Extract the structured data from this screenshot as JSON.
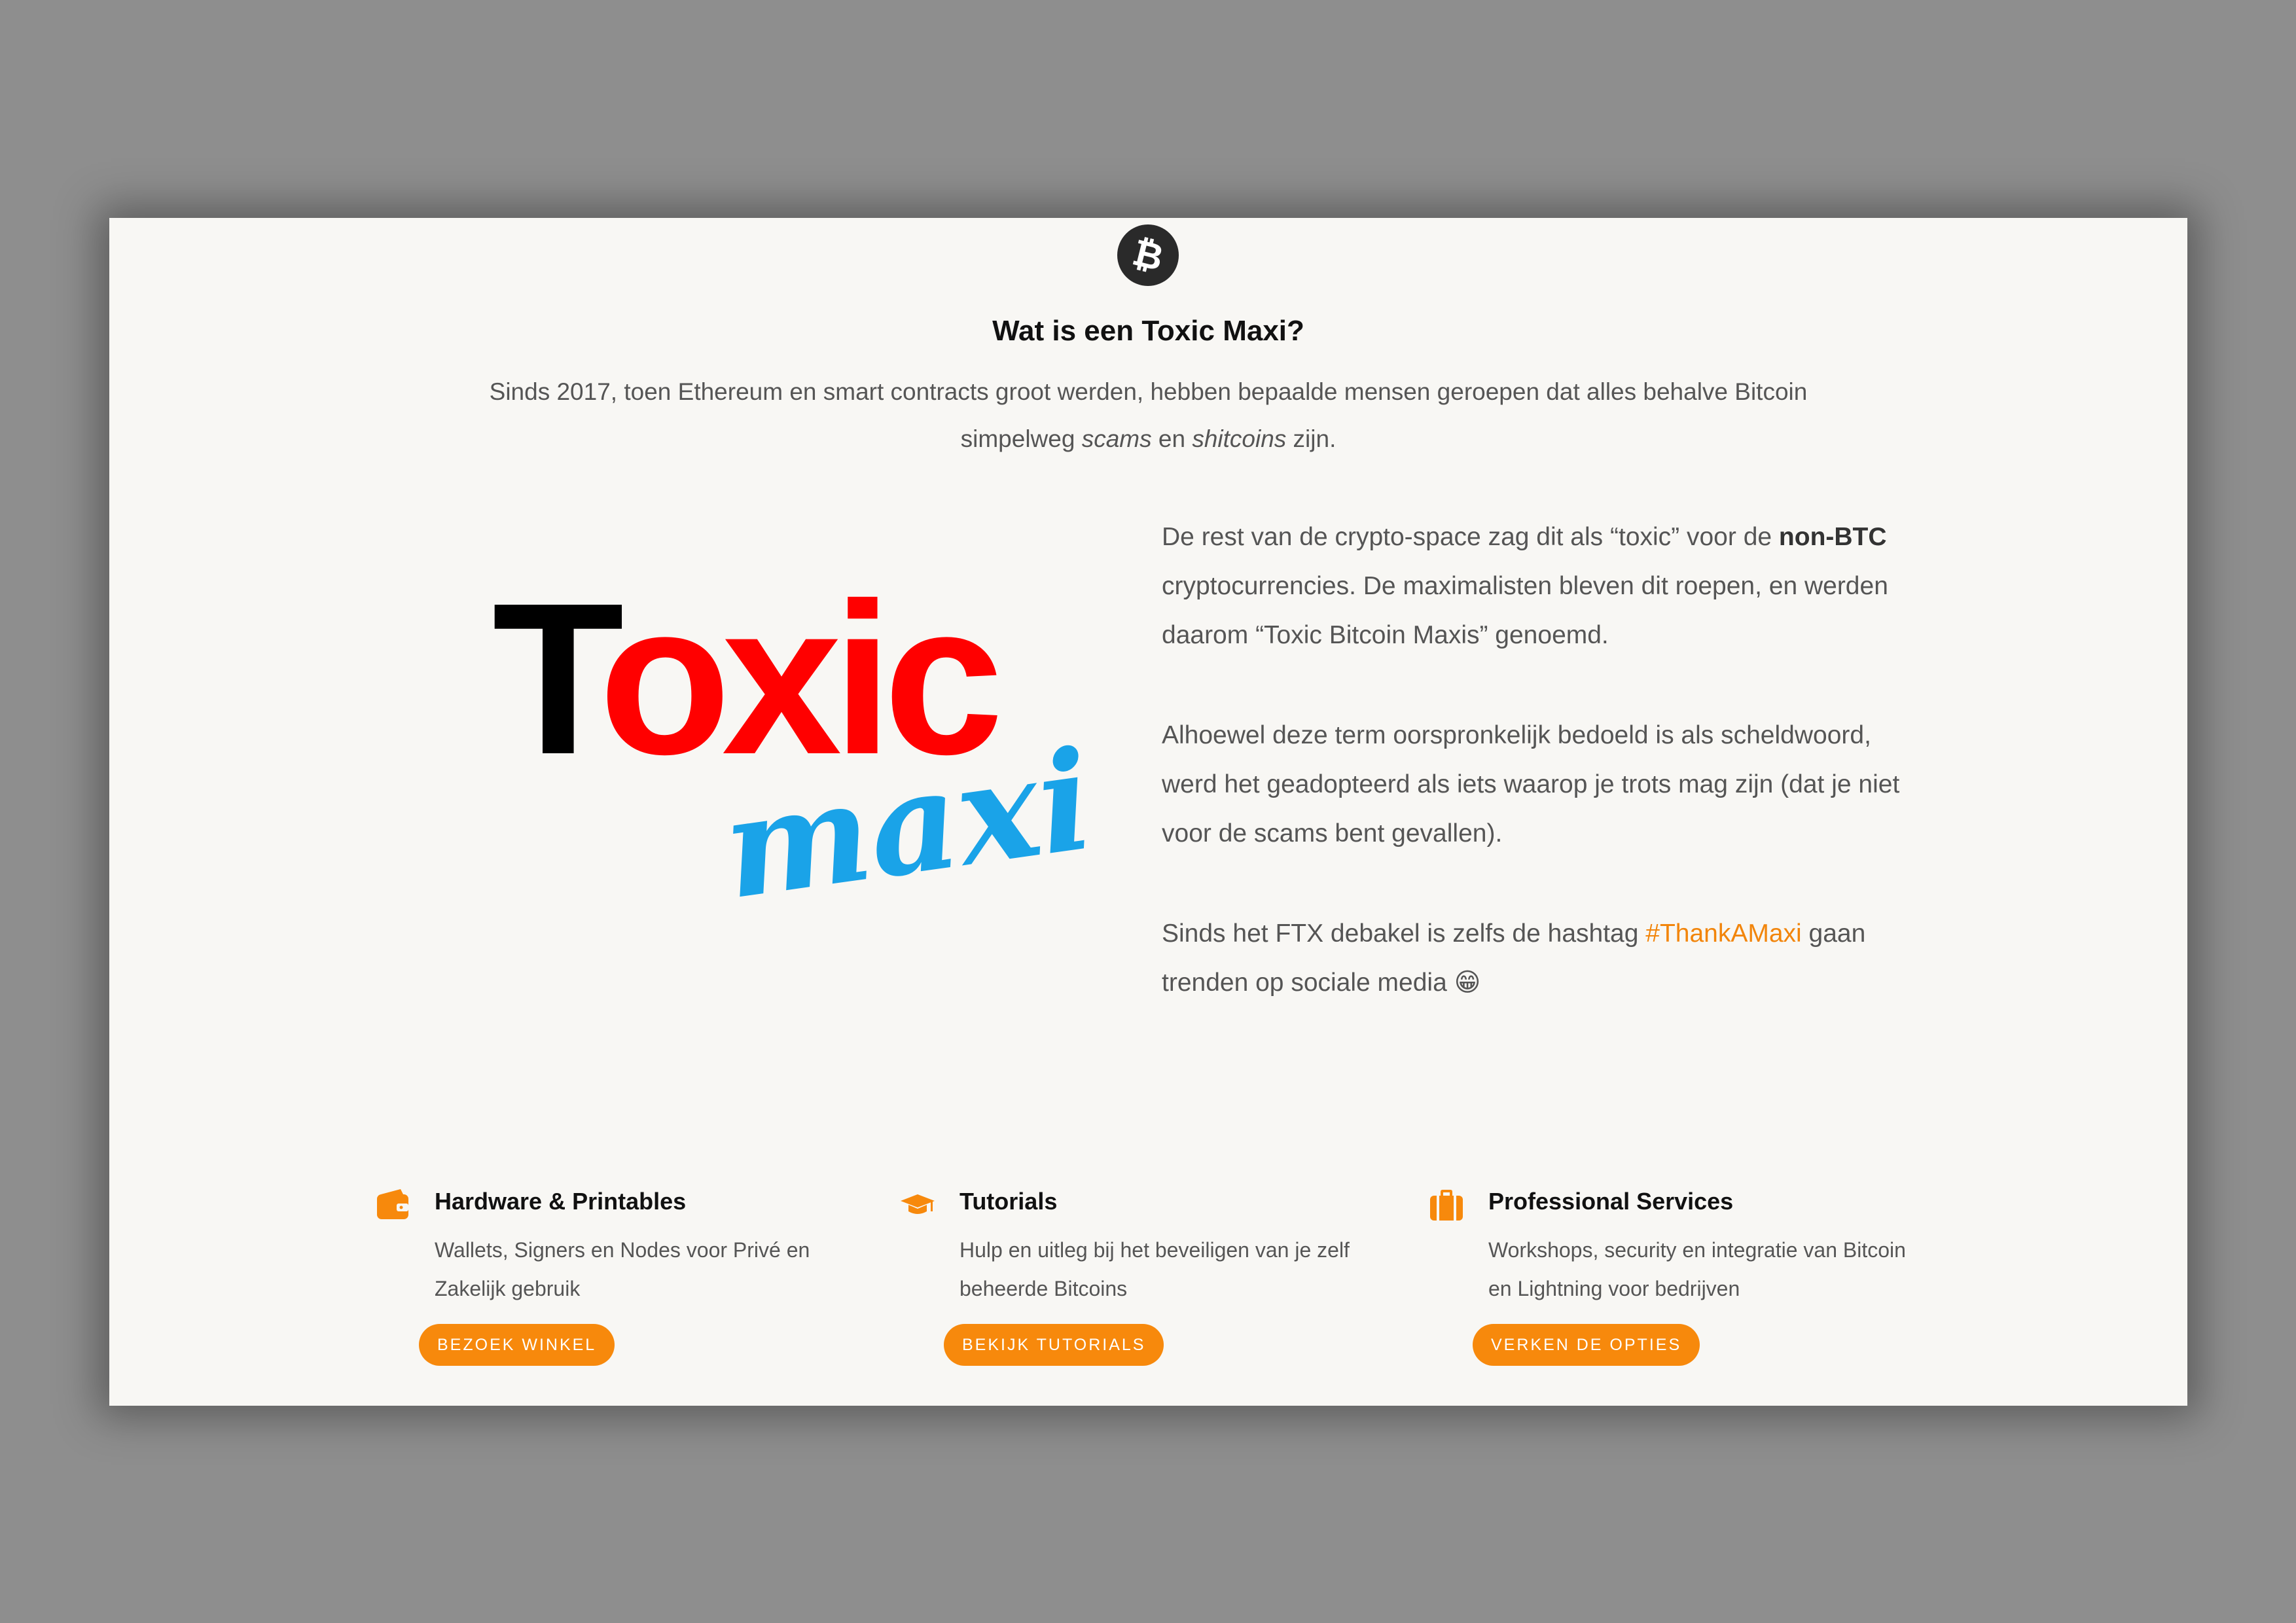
{
  "section": {
    "title": "Wat is een Toxic Maxi?",
    "intro_part1": "Sinds 2017, toen Ethereum en smart contracts groot werden, hebben bepaalde mensen geroepen dat alles behalve Bitcoin simpelweg ",
    "intro_em1": "scams",
    "intro_mid": " en ",
    "intro_em2": "shitcoins",
    "intro_end": " zijn."
  },
  "logo": {
    "word1": "Toxic",
    "word2": "maxi",
    "colors": {
      "t": "#000000",
      "oxic": "#ff0000",
      "maxi": "#1aa3e8"
    }
  },
  "body": {
    "p1_a": "De rest van de crypto-space zag dit als “toxic” voor de ",
    "p1_bold": "non-BTC",
    "p1_b": " cryptocurrencies. De maximalisten bleven dit roepen, en werden daarom “Toxic Bitcoin Maxis” genoemd.",
    "p2": "Alhoewel deze term oorspronkelijk bedoeld is als scheldwoord, werd het geadopteerd als iets waarop je trots mag zijn (dat je niet voor de scams bent gevallen).",
    "p3_a": "Sinds het FTX debakel is zelfs de hashtag ",
    "p3_hashtag": "#ThankAMaxi",
    "p3_b": " gaan trenden op sociale media ",
    "p3_emoji": "😁"
  },
  "features": [
    {
      "icon": "wallet-icon",
      "title": "Hardware & Printables",
      "desc": "Wallets, Signers en Nodes voor Privé en Zakelijk gebruik",
      "button": "BEZOEK WINKEL"
    },
    {
      "icon": "graduation-cap-icon",
      "title": "Tutorials",
      "desc": "Hulp en uitleg bij het beveiligen van je zelf beheerde Bitcoins",
      "button": "BEKIJK TUTORIALS"
    },
    {
      "icon": "briefcase-icon",
      "title": "Professional Services",
      "desc": "Workshops, security en integratie van Bitcoin en Lightning voor bedrijven",
      "button": "VERKEN DE OPTIES"
    }
  ],
  "colors": {
    "accent": "#f7890c",
    "background": "#8e8e8e",
    "card": "#f8f7f4"
  }
}
